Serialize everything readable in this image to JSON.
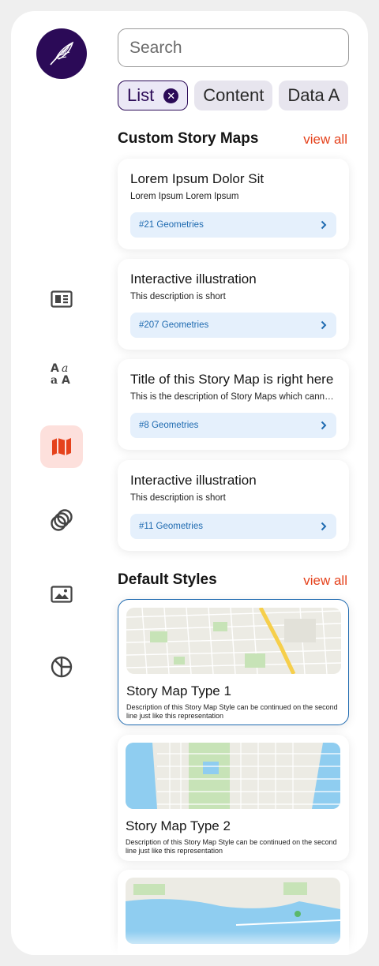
{
  "search": {
    "placeholder": "Search"
  },
  "chips": [
    {
      "label": "List",
      "selected": true
    },
    {
      "label": "Content",
      "selected": false
    },
    {
      "label": "Data A",
      "selected": false
    }
  ],
  "sidebar": {
    "items": [
      {
        "icon": "article-icon",
        "active": false
      },
      {
        "icon": "typography-icon",
        "active": true,
        "note": ""
      },
      {
        "icon": "map-icon",
        "active": true
      },
      {
        "icon": "layers-circles-icon",
        "active": false
      },
      {
        "icon": "image-icon",
        "active": false
      },
      {
        "icon": "chart-pie-icon",
        "active": false
      }
    ]
  },
  "custom_story_maps": {
    "title": "Custom Story Maps",
    "view_all": "view all",
    "cards": [
      {
        "title": "Lorem Ipsum Dolor Sit",
        "description": "Lorem Ipsum Lorem Ipsum",
        "geometries": "#21 Geometries"
      },
      {
        "title": "Interactive illustration",
        "description": "This description is short",
        "geometries": "#207 Geometries"
      },
      {
        "title": "Title of this Story Map is right here",
        "description": "This is the description of Story Maps which cannot be shown in full",
        "geometries": "#8 Geometries"
      },
      {
        "title": "Interactive illustration",
        "description": "This description is short",
        "geometries": "#11 Geometries"
      }
    ]
  },
  "default_styles": {
    "title": "Default Styles",
    "view_all": "view all",
    "cards": [
      {
        "title": "Story Map Type 1",
        "description": "Description of this Story Map Style can be continued on the second line just like this representation",
        "selected": true
      },
      {
        "title": "Story Map Type 2",
        "description": "Description of this Story Map Style can be continued on the second line just like this representation",
        "selected": false
      },
      {
        "title": "",
        "description": "",
        "selected": false
      }
    ]
  },
  "colors": {
    "brand": "#2b0a57",
    "accent": "#e5421c",
    "link": "#1e6ab0",
    "active_bg": "#fde0dc"
  }
}
